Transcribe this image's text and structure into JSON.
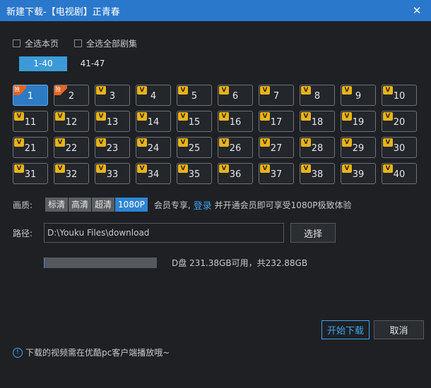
{
  "window": {
    "title": "新建下载-【电视剧】正青春",
    "close_glyph": "✕"
  },
  "select": {
    "page_label": "全选本页",
    "all_label": "全选全部剧集"
  },
  "range_tabs": [
    {
      "label": "1-40",
      "active": true
    },
    {
      "label": "41-47",
      "active": false
    }
  ],
  "episodes": [
    {
      "num": "1",
      "badge": "独",
      "selected": true
    },
    {
      "num": "2",
      "badge": "独",
      "selected": false
    },
    {
      "num": "3",
      "badge": "V"
    },
    {
      "num": "4",
      "badge": "V"
    },
    {
      "num": "5",
      "badge": "V"
    },
    {
      "num": "6",
      "badge": "V"
    },
    {
      "num": "7",
      "badge": "V"
    },
    {
      "num": "8",
      "badge": "V"
    },
    {
      "num": "9",
      "badge": "V"
    },
    {
      "num": "10",
      "badge": "V"
    },
    {
      "num": "11",
      "badge": "V"
    },
    {
      "num": "12",
      "badge": "V"
    },
    {
      "num": "13",
      "badge": "V"
    },
    {
      "num": "14",
      "badge": "V"
    },
    {
      "num": "15",
      "badge": "V"
    },
    {
      "num": "16",
      "badge": "V"
    },
    {
      "num": "17",
      "badge": "V"
    },
    {
      "num": "18",
      "badge": "V"
    },
    {
      "num": "19",
      "badge": "V"
    },
    {
      "num": "20",
      "badge": "V"
    },
    {
      "num": "21",
      "badge": "V"
    },
    {
      "num": "22",
      "badge": "V"
    },
    {
      "num": "23",
      "badge": "V"
    },
    {
      "num": "24",
      "badge": "V"
    },
    {
      "num": "25",
      "badge": "V"
    },
    {
      "num": "26",
      "badge": "V"
    },
    {
      "num": "27",
      "badge": "V"
    },
    {
      "num": "28",
      "badge": "V"
    },
    {
      "num": "29",
      "badge": "V"
    },
    {
      "num": "30",
      "badge": "V"
    },
    {
      "num": "31",
      "badge": "V"
    },
    {
      "num": "32",
      "badge": "V"
    },
    {
      "num": "33",
      "badge": "V"
    },
    {
      "num": "34",
      "badge": "V"
    },
    {
      "num": "35",
      "badge": "V"
    },
    {
      "num": "36",
      "badge": "V"
    },
    {
      "num": "37",
      "badge": "V"
    },
    {
      "num": "38",
      "badge": "V"
    },
    {
      "num": "39",
      "badge": "V"
    },
    {
      "num": "40",
      "badge": "V"
    }
  ],
  "quality": {
    "label": "画质:",
    "options": [
      "标清",
      "高清",
      "超清",
      "1080P"
    ],
    "selected": "1080P",
    "note_prefix": "会员专享,",
    "login_link": "登录",
    "note_suffix": "并开通会员即可享受1080P极致体验"
  },
  "path": {
    "label": "路径:",
    "value": "D:\\Youku Files\\download",
    "browse": "选择"
  },
  "disk": {
    "text": "D盘 231.38GB可用，共232.88GB",
    "used_fraction": 0.006
  },
  "buttons": {
    "start": "开始下载",
    "cancel": "取消"
  },
  "footnote": {
    "icon": "info-icon",
    "text": "下载的视频需在优酷pc客户端播放哦~"
  },
  "colors": {
    "accent": "#3ea3ec",
    "titlebar": "#2a78cc",
    "vip_badge": "#e8b31a",
    "exclusive_badge": "#e8641e"
  }
}
